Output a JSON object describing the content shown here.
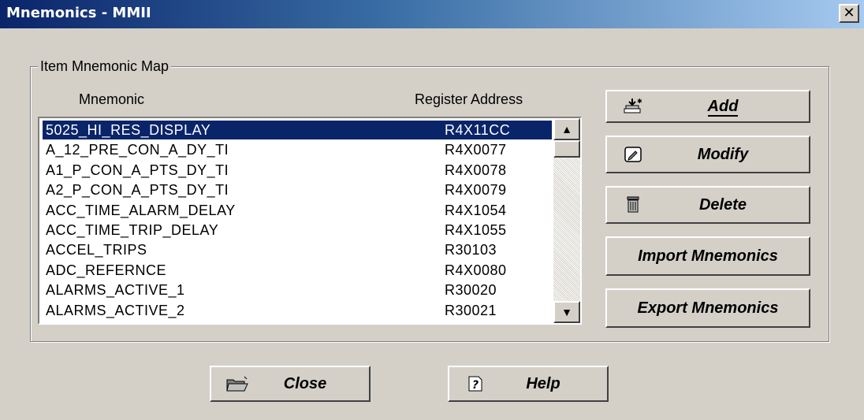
{
  "window": {
    "title": "Mnemonics - MMII",
    "close_glyph": "✕"
  },
  "group": {
    "label": "Item Mnemonic Map"
  },
  "columns": {
    "mnemonic": "Mnemonic",
    "register": "Register Address"
  },
  "rows": [
    {
      "mnemonic": "5025_HI_RES_DISPLAY",
      "address": "R4X11CC",
      "selected": true
    },
    {
      "mnemonic": "A_12_PRE_CON_A_DY_TI",
      "address": "R4X0077"
    },
    {
      "mnemonic": "A1_P_CON_A_PTS_DY_TI",
      "address": "R4X0078"
    },
    {
      "mnemonic": "A2_P_CON_A_PTS_DY_TI",
      "address": "R4X0079"
    },
    {
      "mnemonic": "ACC_TIME_ALARM_DELAY",
      "address": "R4X1054"
    },
    {
      "mnemonic": "ACC_TIME_TRIP_DELAY",
      "address": "R4X1055"
    },
    {
      "mnemonic": "ACCEL_TRIPS",
      "address": "R30103"
    },
    {
      "mnemonic": "ADC_REFERNCE",
      "address": "R4X0080"
    },
    {
      "mnemonic": "ALARMS_ACTIVE_1",
      "address": "R30020"
    },
    {
      "mnemonic": "ALARMS_ACTIVE_2",
      "address": "R30021"
    }
  ],
  "scrollbar": {
    "up_glyph": "▲",
    "down_glyph": "▼"
  },
  "buttons": {
    "add": "Add",
    "modify": "Modify",
    "delete": "Delete",
    "import": "Import Mnemonics",
    "export": "Export Mnemonics",
    "close": "Close",
    "help": "Help"
  }
}
